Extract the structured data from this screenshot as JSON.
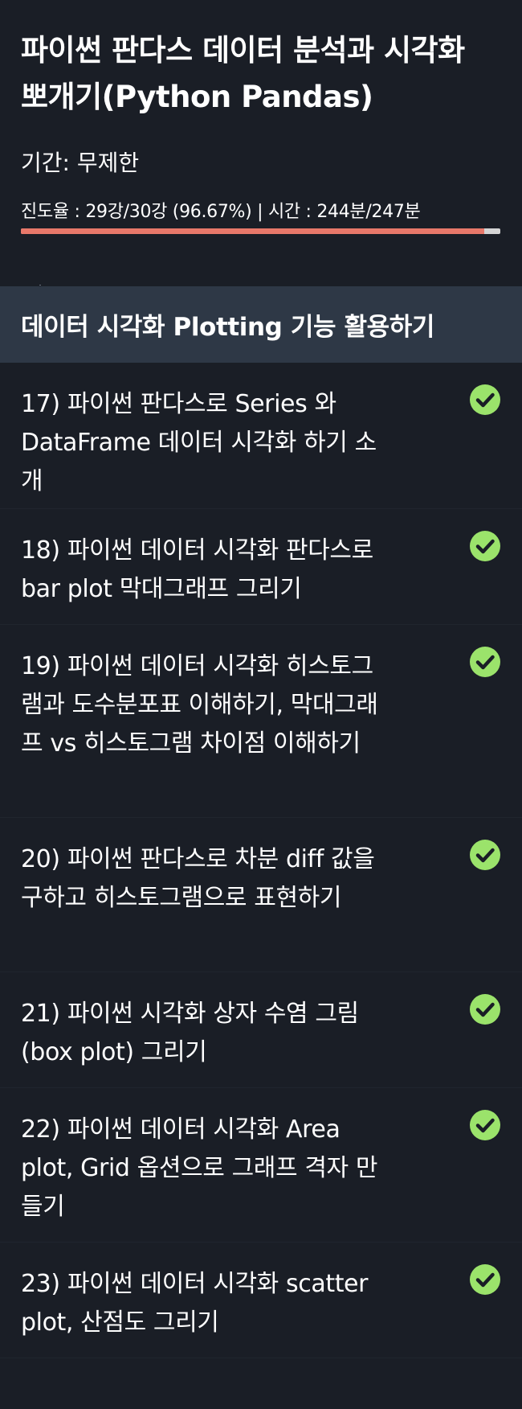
{
  "course": {
    "title": "파이썬 판다스 데이터 분석과 시각화 뽀개기(Python Pandas)",
    "period": "기간: 무제한",
    "progress_text": "진도율 : 29강/30강 (96.67%) | 시간 : 244분/247분",
    "progress_fraction": 0.9667
  },
  "colors": {
    "background": "#1a1e26",
    "section_bg": "#2e3846",
    "progress_fill": "#e8786a",
    "progress_track": "#d4d4d4",
    "check_green": "#9be36b"
  },
  "section": {
    "title": "데이터 시각화 Plotting 기능 활용하기"
  },
  "lessons": [
    {
      "title": "17) 파이썬 판다스로 Series 와 DataFrame 데이터 시각화 하기 소개",
      "icon": "check-circle-icon",
      "completed": true
    },
    {
      "title": "18) 파이썬 데이터 시각화 판다스로 bar plot 막대그래프 그리기",
      "icon": "check-circle-icon",
      "completed": true
    },
    {
      "title": "19) 파이썬 데이터 시각화 히스토그램과 도수분포표 이해하기, 막대그래프 vs 히스토그램 차이점 이해하기",
      "icon": "check-circle-icon",
      "completed": true
    },
    {
      "title": "20) 파이썬 판다스로 차분 diff 값을 구하고 히스토그램으로 표현하기",
      "icon": "check-circle-icon",
      "completed": true
    },
    {
      "title": "21) 파이썬 시각화 상자 수염 그림(box plot) 그리기",
      "icon": "check-circle-icon",
      "completed": true
    },
    {
      "title": "22) 파이썬 데이터 시각화 Area plot, Grid 옵션으로 그래프 격자 만들기",
      "icon": "check-circle-icon",
      "completed": true
    },
    {
      "title": "23) 파이썬 데이터 시각화 scatter plot, 산점도 그리기",
      "icon": "check-circle-icon",
      "completed": true
    }
  ]
}
